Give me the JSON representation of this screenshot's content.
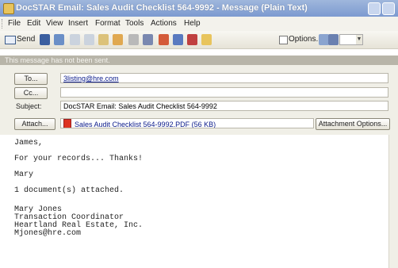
{
  "window": {
    "title": "DocSTAR Email: Sales Audit Checklist 564-9992 - Message (Plain Text)"
  },
  "menu": [
    "File",
    "Edit",
    "View",
    "Insert",
    "Format",
    "Tools",
    "Actions",
    "Help"
  ],
  "toolbar": {
    "send_label": "Send",
    "options_label": "Options..."
  },
  "infobar": "This message has not been sent.",
  "header": {
    "to_button": "To...",
    "to_value": "3listing@hre.com",
    "cc_button": "Cc...",
    "cc_value": "",
    "subject_label": "Subject:",
    "subject_value": "DocSTAR Email: Sales Audit Checklist 564-9992",
    "attach_button": "Attach...",
    "attachment_name": "Sales Audit Checklist 564-9992.PDF (56 KB)",
    "attachment_options": "Attachment Options..."
  },
  "message": {
    "greeting": "James,",
    "line1": "For your records... Thanks!",
    "signoff": "Mary",
    "docs": "1 document(s) attached.",
    "sig_name": "Mary Jones",
    "sig_title": "Transaction Coordinator",
    "sig_company": "Heartland Real Estate, Inc.",
    "sig_email": "Mjones@hre.com"
  },
  "icons": [
    "app-icon",
    "minimize-icon",
    "maximize-icon",
    "send-icon",
    "save-icon",
    "attach-icon",
    "pdf-icon",
    "options-icon"
  ]
}
